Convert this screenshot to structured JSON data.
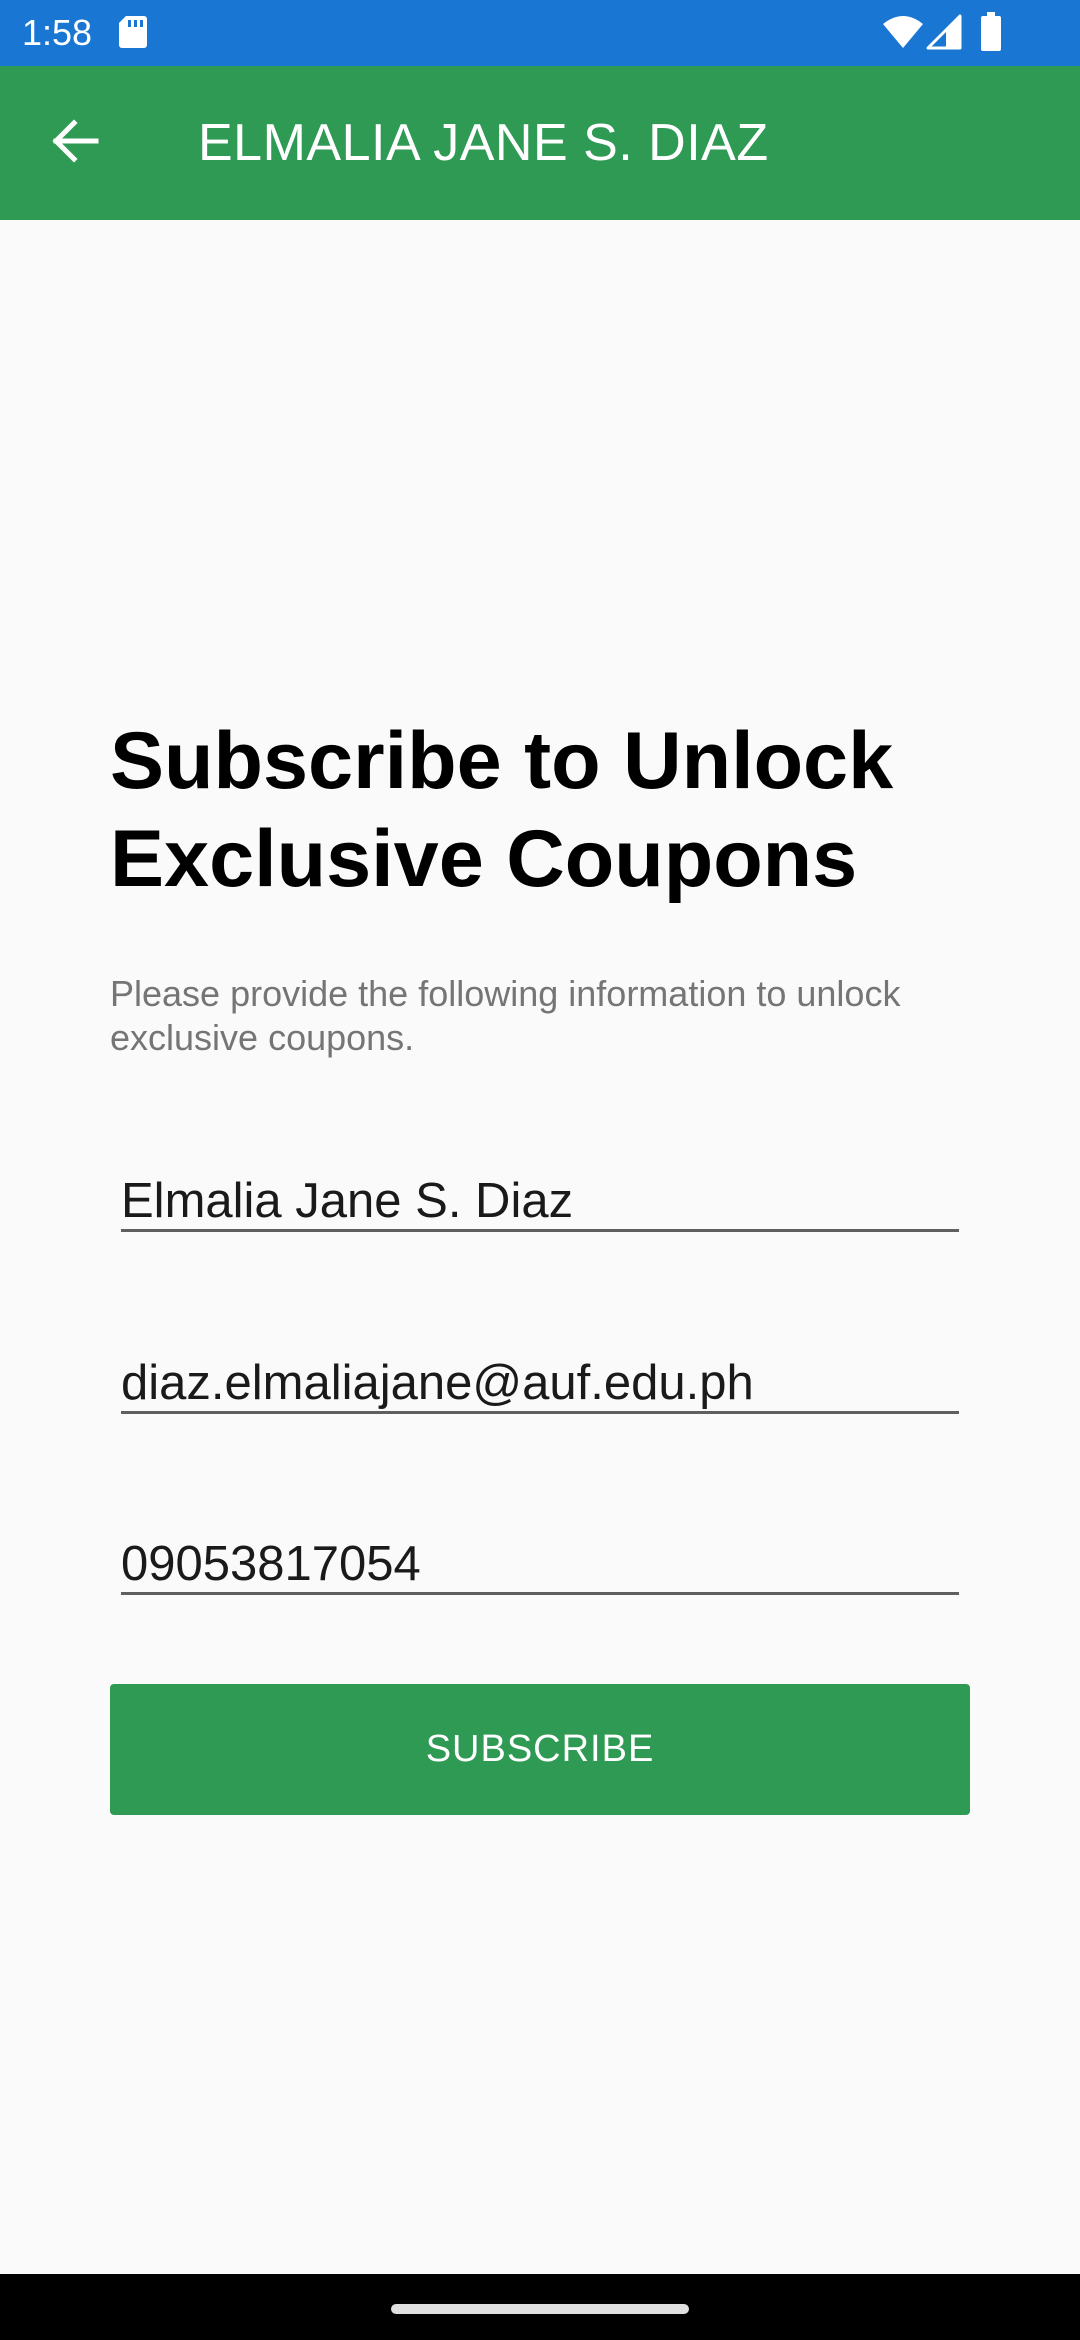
{
  "status_bar": {
    "time": "1:58",
    "icons": [
      "sd-card-icon",
      "wifi-icon",
      "signal-icon",
      "battery-icon"
    ]
  },
  "app_bar": {
    "back_icon": "arrow-back-icon",
    "title": "ELMALIA JANE S. DIAZ"
  },
  "main": {
    "headline": "Subscribe to Unlock Exclusive Coupons",
    "subtitle": "Please provide the following information to unlock exclusive coupons.",
    "fields": {
      "name": "Elmalia Jane S. Diaz",
      "email": "diaz.elmaliajane@auf.edu.ph",
      "phone": "09053817054"
    },
    "subscribe_label": "SUBSCRIBE"
  },
  "colors": {
    "status_bar": "#1976d2",
    "primary": "#2e9a53",
    "background": "#fafafa",
    "subtitle_text": "#757575"
  }
}
